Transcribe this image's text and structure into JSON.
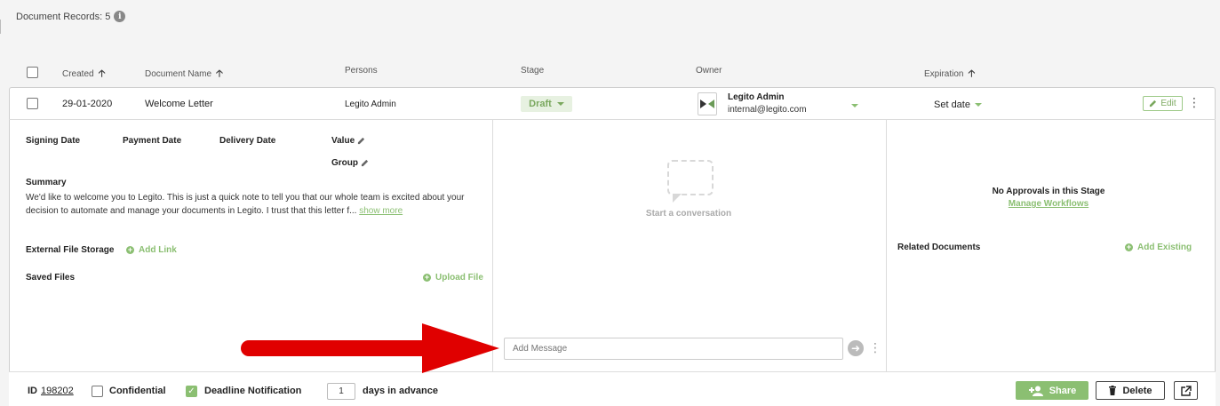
{
  "records": {
    "label": "Document Records: 5",
    "info_icon": "info-icon"
  },
  "columns": {
    "created": "Created",
    "document_name": "Document Name",
    "persons": "Persons",
    "stage": "Stage",
    "owner": "Owner",
    "expiration": "Expiration",
    "sort_arrow": "🡡"
  },
  "row": {
    "created": "29-01-2020",
    "document_name": "Welcome Letter",
    "persons": "Legito Admin",
    "stage": "Draft",
    "owner_name": "Legito Admin",
    "owner_email": "internal@legito.com",
    "expiration": "Set date",
    "edit_label": "Edit"
  },
  "details": {
    "signing_date": "Signing Date",
    "payment_date": "Payment Date",
    "delivery_date": "Delivery Date",
    "value": "Value",
    "group": "Group",
    "summary_label": "Summary",
    "summary_text": "We'd like to welcome you to Legito. This is just a quick note to tell you that our whole team is excited about your decision to automate and manage your documents in Legito. I trust that this letter f...",
    "show_more": "show more",
    "external_storage": "External File Storage",
    "add_link": "Add Link",
    "saved_files": "Saved Files",
    "upload_file": "Upload File"
  },
  "conversation": {
    "start": "Start a conversation",
    "message_placeholder": "Add Message"
  },
  "approvals": {
    "none": "No Approvals in this Stage",
    "manage": "Manage Workflows",
    "related": "Related Documents",
    "add_existing": "Add Existing"
  },
  "footer": {
    "id_label": "ID",
    "id_value": "198202",
    "confidential": "Confidential",
    "deadline": "Deadline Notification",
    "days_value": "1",
    "days_suffix": "days in advance",
    "share": "Share",
    "delete": "Delete"
  },
  "colors": {
    "accent": "#8bbf72",
    "arrow": "#e00000"
  }
}
